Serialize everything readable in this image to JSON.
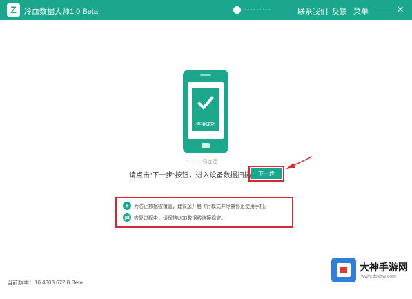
{
  "titlebar": {
    "app_title": "冷血数据大师1.0 Beta",
    "user_name": "·········",
    "nav_contact": "联系我们",
    "nav_feedback": "反馈",
    "nav_menu": "菜单",
    "min_label": "—",
    "close_label": "✕",
    "logo_icon": "Z"
  },
  "phone": {
    "connect_text": "连接成功"
  },
  "device": {
    "status_text": "\"········\"已连接"
  },
  "main": {
    "instruction": "请点击“下一步”按钮，进入设备数据扫描",
    "next_button": "下一步"
  },
  "tips": [
    {
      "icon": "+",
      "text": "为防止数据被覆盖，建议您开启飞行模式并尽量停止使用手机。"
    },
    {
      "icon": "⇄",
      "text": "恢复过程中，请保持USB数据线连接稳定。"
    }
  ],
  "footer": {
    "version": "当前版本：10.4303.672.8 Beta"
  },
  "watermark": {
    "title": "大神手游网",
    "url": "www.dsxsw.com"
  },
  "colors": {
    "brand": "#1aa78e",
    "highlight": "#d42a36"
  }
}
